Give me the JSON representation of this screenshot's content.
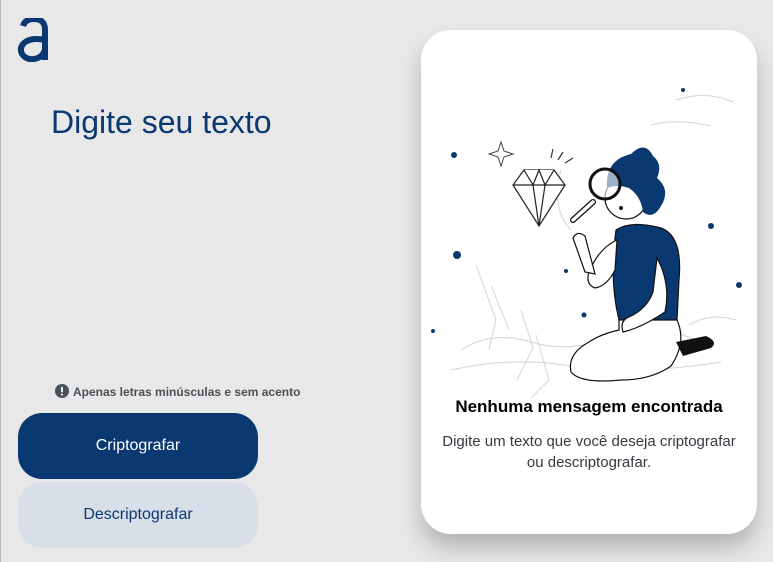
{
  "app": {
    "logo_icon": "a-logo-icon",
    "accent_color": "#0a3871"
  },
  "input": {
    "placeholder": "Digite seu texto",
    "value": ""
  },
  "hint": {
    "icon": "exclamation-circle-icon",
    "text": "Apenas letras minúsculas e sem acento"
  },
  "buttons": {
    "encrypt_label": "Criptografar",
    "decrypt_label": "Descriptografar"
  },
  "output": {
    "illustration": "boy-with-magnifying-glass-looking-at-diamond-illustration",
    "title": "Nenhuma mensagem encontrada",
    "subtitle": "Digite um texto que você deseja criptografar ou descriptografar."
  }
}
